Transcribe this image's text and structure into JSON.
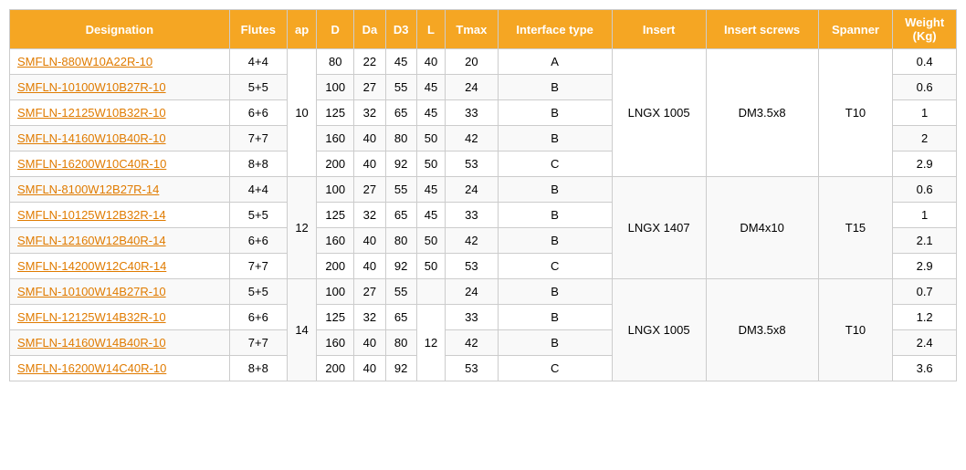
{
  "table": {
    "headers": [
      "Designation",
      "Flutes",
      "ap",
      "D",
      "Da",
      "D3",
      "L",
      "Tmax",
      "Interface type",
      "Insert",
      "Insert screws",
      "Spanner",
      "Weight\n(Kg)"
    ],
    "rows": [
      {
        "designation": "SMFLN-880W10A22R-10",
        "flutes": "4+4",
        "ap": "",
        "D": "80",
        "Da": "22",
        "D3": "45",
        "L": "40",
        "Tmax": "20",
        "interface_type": "A",
        "insert": "",
        "insert_screws": "",
        "spanner": "",
        "weight": "0.4",
        "rowspan_insert": 5,
        "rowspan_screws": 5,
        "rowspan_spanner": 5,
        "insert_val": "LNGX 1005",
        "screws_val": "DM3.5x8",
        "spanner_val": "T10"
      },
      {
        "designation": "SMFLN-10100W10B27R-10",
        "flutes": "5+5",
        "ap": "",
        "D": "100",
        "Da": "27",
        "D3": "55",
        "L": "45",
        "Tmax": "24",
        "interface_type": "B",
        "insert": null,
        "insert_screws": null,
        "spanner": null,
        "weight": "0.6"
      },
      {
        "designation": "SMFLN-12125W10B32R-10",
        "flutes": "6+6",
        "ap": "10",
        "D": "125",
        "Da": "32",
        "D3": "65",
        "L": "45",
        "Tmax": "33",
        "interface_type": "B",
        "insert": null,
        "insert_screws": null,
        "spanner": null,
        "weight": "1"
      },
      {
        "designation": "SMFLN-14160W10B40R-10",
        "flutes": "7+7",
        "ap": "",
        "D": "160",
        "Da": "40",
        "D3": "80",
        "L": "50",
        "Tmax": "42",
        "interface_type": "B",
        "insert": null,
        "insert_screws": null,
        "spanner": null,
        "weight": "2"
      },
      {
        "designation": "SMFLN-16200W10C40R-10",
        "flutes": "8+8",
        "ap": "",
        "D": "200",
        "Da": "40",
        "D3": "92",
        "L": "50",
        "Tmax": "53",
        "interface_type": "C",
        "insert": null,
        "insert_screws": null,
        "spanner": null,
        "weight": "2.9"
      },
      {
        "designation": "SMFLN-8100W12B27R-14",
        "flutes": "4+4",
        "ap": "",
        "D": "100",
        "Da": "27",
        "D3": "55",
        "L": "45",
        "Tmax": "24",
        "interface_type": "B",
        "insert": "show",
        "insert_screws": "show",
        "spanner": "show",
        "insert_val": "LNGX 1407",
        "screws_val": "DM4x10",
        "spanner_val": "T15",
        "rowspan_insert": 4,
        "rowspan_screws": 4,
        "rowspan_spanner": 4,
        "weight": "0.6"
      },
      {
        "designation": "SMFLN-10125W12B32R-14",
        "flutes": "5+5",
        "ap": "12",
        "D": "125",
        "Da": "32",
        "D3": "65",
        "L": "45",
        "Tmax": "33",
        "interface_type": "B",
        "insert": null,
        "insert_screws": null,
        "spanner": null,
        "weight": "1"
      },
      {
        "designation": "SMFLN-12160W12B40R-14",
        "flutes": "6+6",
        "ap": "",
        "D": "160",
        "Da": "40",
        "D3": "80",
        "L": "50",
        "Tmax": "42",
        "interface_type": "B",
        "insert": null,
        "insert_screws": null,
        "spanner": null,
        "weight": "2.1"
      },
      {
        "designation": "SMFLN-14200W12C40R-14",
        "flutes": "7+7",
        "ap": "",
        "D": "200",
        "Da": "40",
        "D3": "92",
        "L": "50",
        "Tmax": "53",
        "interface_type": "C",
        "insert": null,
        "insert_screws": null,
        "spanner": null,
        "weight": "2.9"
      },
      {
        "designation": "SMFLN-10100W14B27R-10",
        "flutes": "5+5",
        "ap": "",
        "D": "100",
        "Da": "27",
        "D3": "55",
        "L": "",
        "Tmax": "24",
        "interface_type": "B",
        "insert": "show",
        "insert_screws": "show",
        "spanner": "show",
        "insert_val": "LNGX 1005",
        "screws_val": "DM3.5x8",
        "spanner_val": "T10",
        "rowspan_insert": 4,
        "rowspan_screws": 4,
        "rowspan_spanner": 4,
        "weight": "0.7"
      },
      {
        "designation": "SMFLN-12125W14B32R-10",
        "flutes": "6+6",
        "ap": "14",
        "D": "125",
        "Da": "32",
        "D3": "65",
        "L": "12",
        "Tmax": "33",
        "interface_type": "B",
        "insert": null,
        "insert_screws": null,
        "spanner": null,
        "weight": "1.2"
      },
      {
        "designation": "SMFLN-14160W14B40R-10",
        "flutes": "7+7",
        "ap": "",
        "D": "160",
        "Da": "40",
        "D3": "80",
        "L": "",
        "Tmax": "42",
        "interface_type": "B",
        "insert": null,
        "insert_screws": null,
        "spanner": null,
        "weight": "2.4"
      },
      {
        "designation": "SMFLN-16200W14C40R-10",
        "flutes": "8+8",
        "ap": "",
        "D": "200",
        "Da": "40",
        "D3": "92",
        "L": "",
        "Tmax": "53",
        "interface_type": "C",
        "insert": null,
        "insert_screws": null,
        "spanner": null,
        "weight": "3.6"
      }
    ]
  }
}
